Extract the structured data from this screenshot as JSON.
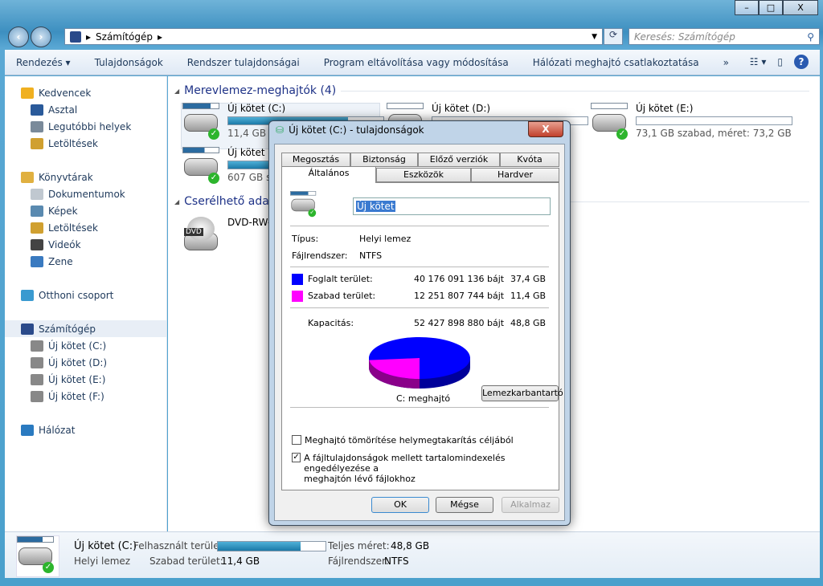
{
  "window": {
    "minimize": "–",
    "maximize": "□",
    "close": "X"
  },
  "address": {
    "crumb": "Számítógép",
    "search_placeholder": "Keresés: Számítógép"
  },
  "toolbar": {
    "items": [
      "Rendezés ▾",
      "Tulajdonságok",
      "Rendszer tulajdonságai",
      "Program eltávolítása vagy módosítása",
      "Hálózati meghajtó csatlakoztatása",
      "»"
    ]
  },
  "sidebar": {
    "items": [
      {
        "label": "Kedvencek",
        "icon": "star-icon",
        "color": "#f0b020",
        "sub": false
      },
      {
        "label": "Asztal",
        "icon": "desktop-icon",
        "color": "#2a5a9a",
        "sub": true
      },
      {
        "label": "Legutóbbi helyek",
        "icon": "recent-places-icon",
        "color": "#7a8a9a",
        "sub": true
      },
      {
        "label": "Letöltések",
        "icon": "downloads-icon",
        "color": "#d0a030",
        "sub": true
      },
      {
        "label": "Könyvtárak",
        "icon": "libraries-icon",
        "color": "#e0b040",
        "sub": false,
        "gap": true
      },
      {
        "label": "Dokumentumok",
        "icon": "documents-icon",
        "color": "#c0c8d0",
        "sub": true
      },
      {
        "label": "Képek",
        "icon": "pictures-icon",
        "color": "#5a8ab0",
        "sub": true
      },
      {
        "label": "Letöltések",
        "icon": "downloads-icon",
        "color": "#d0a030",
        "sub": true
      },
      {
        "label": "Videók",
        "icon": "videos-icon",
        "color": "#444",
        "sub": true
      },
      {
        "label": "Zene",
        "icon": "music-icon",
        "color": "#3a7ac0",
        "sub": true
      },
      {
        "label": "Otthoni csoport",
        "icon": "homegroup-icon",
        "color": "#3a9ad0",
        "sub": false,
        "gap": true
      },
      {
        "label": "Számítógép",
        "icon": "computer-icon",
        "color": "#2a4a8a",
        "sub": false,
        "gap": true,
        "selected": true
      },
      {
        "label": "Új kötet (C:)",
        "icon": "drive-icon",
        "color": "#888",
        "sub": true
      },
      {
        "label": "Új kötet (D:)",
        "icon": "drive-icon",
        "color": "#888",
        "sub": true
      },
      {
        "label": "Új kötet (E:)",
        "icon": "drive-icon",
        "color": "#888",
        "sub": true
      },
      {
        "label": "Új kötet (F:)",
        "icon": "drive-icon",
        "color": "#888",
        "sub": true
      },
      {
        "label": "Hálózat",
        "icon": "network-icon",
        "color": "#2a7ac0",
        "sub": false,
        "gap": true
      }
    ]
  },
  "content": {
    "group_hdd": "Merevlemez-meghajtók (4)",
    "group_removable": "Cserélhető adat",
    "drives": [
      {
        "name": "Új kötet (C:)",
        "info": "11,4 GB sza",
        "used_pct": 77
      },
      {
        "name": "Új kötet (D:)",
        "info": "",
        "used_pct": 0
      },
      {
        "name": "Új kötet (E:)",
        "info": "73,1 GB szabad, méret: 73,2 GB",
        "used_pct": 0
      },
      {
        "name": "Új kötet (F",
        "info": "607 GB sza",
        "used_pct": 60
      }
    ],
    "dvd": {
      "name": "DVD-RW-",
      "badge": "DVD"
    }
  },
  "status": {
    "name": "Új kötet (C:)",
    "type": "Helyi lemez",
    "used_label": "Felhasznált terület:",
    "used_pct": 77,
    "free_label": "Szabad terület:",
    "free": "11,4 GB",
    "total_label": "Teljes méret:",
    "total": "48,8 GB",
    "fs_label": "Fájlrendszer:",
    "fs": "NTFS"
  },
  "dialog": {
    "title": "Új kötet (C:) - tulajdonságok",
    "close": "X",
    "tabs_back": [
      "Megosztás",
      "Biztonság",
      "Előző verziók",
      "Kvóta"
    ],
    "tabs_front": [
      "Általános",
      "Eszközök",
      "Hardver"
    ],
    "active_tab": "Általános",
    "name_value": "Új kötet",
    "type_label": "Típus:",
    "type": "Helyi lemez",
    "fs_label": "Fájlrendszer:",
    "fs": "NTFS",
    "used_label": "Foglalt terület:",
    "used_bytes": "40 176 091 136 bájt",
    "used_gb": "37,4 GB",
    "used_color": "#0000ff",
    "free_label": "Szabad terület:",
    "free_bytes": "12 251 807 744 bájt",
    "free_gb": "11,4 GB",
    "free_color": "#ff00ff",
    "cap_label": "Kapacitás:",
    "cap_bytes": "52 427 898 880 bájt",
    "cap_gb": "48,8 GB",
    "drive_label": "C: meghajtó",
    "cleanup": "Lemezkarbantartó",
    "compress_label": "Meghajtó tömörítése helymegtakarítás céljából",
    "compress_checked": false,
    "index_label_1": "A fájltulajdonságok mellett tartalomindexelés engedélyezése a",
    "index_label_2": "meghajtón lévő fájlokhoz",
    "index_checked": true,
    "ok": "OK",
    "cancel": "Mégse",
    "apply": "Alkalmaz"
  }
}
